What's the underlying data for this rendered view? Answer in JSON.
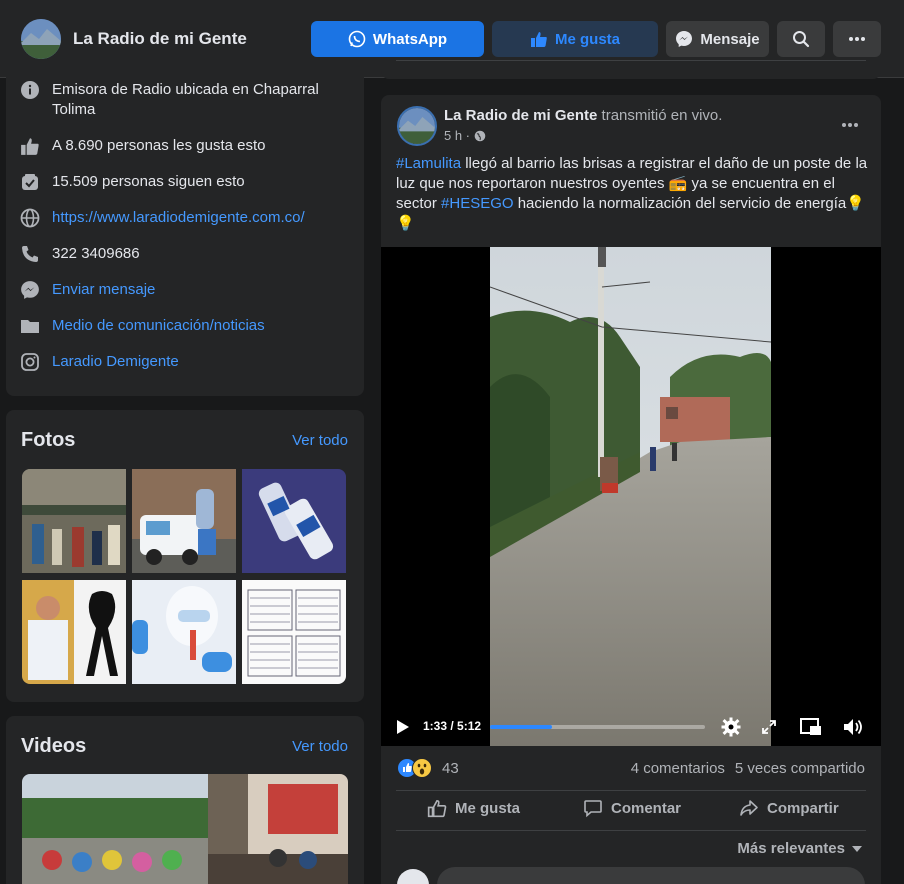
{
  "header": {
    "page_name": "La Radio de mi Gente",
    "whatsapp_label": "WhatsApp",
    "like_label": "Me gusta",
    "message_label": "Mensaje"
  },
  "about": {
    "description": "Emisora de Radio ubicada en Chaparral Tolima",
    "likes": "A 8.690 personas les gusta esto",
    "followers": "15.509 personas siguen esto",
    "website": "https://www.laradiodemigente.com.co/",
    "phone": "322 3409686",
    "send_message": "Enviar mensaje",
    "category": "Medio de comunicación/noticias",
    "instagram": "Laradio Demigente"
  },
  "photos": {
    "title": "Fotos",
    "see_all": "Ver todo"
  },
  "videos": {
    "title": "Videos",
    "see_all": "Ver todo"
  },
  "post": {
    "author": "La Radio de mi Gente",
    "action": "transmitió en vivo.",
    "time": "5 h ·",
    "hashtag1": "#Lamulita",
    "text1": " llegó al barrio las brisas a registrar el daño de un poste de la luz que nos reportaron nuestros oyentes 📻 ya se encuentra en el sector ",
    "hashtag2": "#HESEGO",
    "text2": "  haciendo la normalización del servicio de energía💡💡",
    "video_time": "1:33 / 5:12",
    "video_progress": 0.29,
    "reaction_count": "43",
    "comments": "4 comentarios",
    "shares": "5 veces compartido",
    "like_action": "Me gusta",
    "comment_action": "Comentar",
    "share_action": "Compartir",
    "relevance": "Más relevantes"
  },
  "colors": {
    "background": "#18191a",
    "card": "#242526",
    "accent": "#1b74e4",
    "link": "#4599ff"
  }
}
